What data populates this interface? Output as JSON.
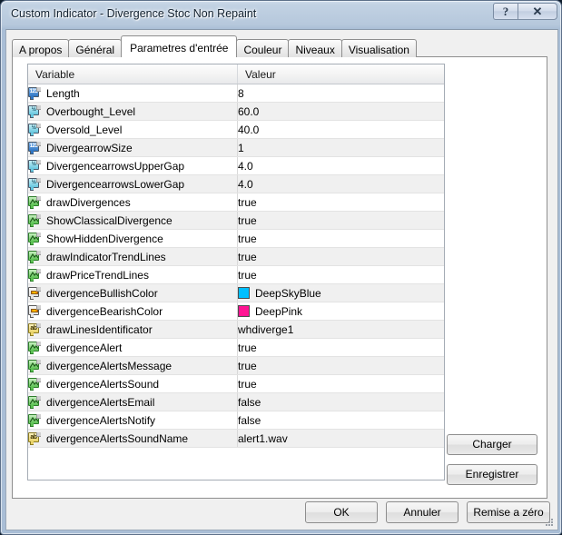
{
  "window": {
    "title": "Custom Indicator - Divergence Stoc Non Repaint",
    "help_button": "?",
    "close_button": "✕"
  },
  "tabs": [
    {
      "label": "A propos",
      "active": false
    },
    {
      "label": "Général",
      "active": false
    },
    {
      "label": "Parametres d'entrée",
      "active": true
    },
    {
      "label": "Couleur",
      "active": false
    },
    {
      "label": "Niveaux",
      "active": false
    },
    {
      "label": "Visualisation",
      "active": false
    }
  ],
  "grid": {
    "headers": [
      "Variable",
      "Valeur"
    ],
    "rows": [
      {
        "icon": "int-icon",
        "type": "int",
        "variable": "Length",
        "value": "8"
      },
      {
        "icon": "double-icon",
        "type": "double",
        "variable": "Overbought_Level",
        "value": "60.0"
      },
      {
        "icon": "double-icon",
        "type": "double",
        "variable": "Oversold_Level",
        "value": "40.0"
      },
      {
        "icon": "int-icon",
        "type": "int",
        "variable": "DivergearrowSize",
        "value": "1"
      },
      {
        "icon": "double-icon",
        "type": "double",
        "variable": "DivergencearrowsUpperGap",
        "value": "4.0"
      },
      {
        "icon": "double-icon",
        "type": "double",
        "variable": "DivergencearrowsLowerGap",
        "value": "4.0"
      },
      {
        "icon": "bool-icon",
        "type": "bool",
        "variable": "drawDivergences",
        "value": "true"
      },
      {
        "icon": "bool-icon",
        "type": "bool",
        "variable": "ShowClassicalDivergence",
        "value": "true"
      },
      {
        "icon": "bool-icon",
        "type": "bool",
        "variable": "ShowHiddenDivergence",
        "value": "true"
      },
      {
        "icon": "bool-icon",
        "type": "bool",
        "variable": "drawIndicatorTrendLines",
        "value": "true"
      },
      {
        "icon": "bool-icon",
        "type": "bool",
        "variable": "drawPriceTrendLines",
        "value": "true"
      },
      {
        "icon": "color-icon",
        "type": "color",
        "variable": "divergenceBullishColor",
        "value": "DeepSkyBlue",
        "swatch": "#00BFFF"
      },
      {
        "icon": "color-icon",
        "type": "color",
        "variable": "divergenceBearishColor",
        "value": "DeepPink",
        "swatch": "#FF1493"
      },
      {
        "icon": "string-icon",
        "type": "string",
        "variable": "drawLinesIdentificator",
        "value": "whdiverge1"
      },
      {
        "icon": "bool-icon",
        "type": "bool",
        "variable": "divergenceAlert",
        "value": "true"
      },
      {
        "icon": "bool-icon",
        "type": "bool",
        "variable": "divergenceAlertsMessage",
        "value": "true"
      },
      {
        "icon": "bool-icon",
        "type": "bool",
        "variable": "divergenceAlertsSound",
        "value": "true"
      },
      {
        "icon": "bool-icon",
        "type": "bool",
        "variable": "divergenceAlertsEmail",
        "value": "false"
      },
      {
        "icon": "bool-icon",
        "type": "bool",
        "variable": "divergenceAlertsNotify",
        "value": "false"
      },
      {
        "icon": "string-icon",
        "type": "string",
        "variable": "divergenceAlertsSoundName",
        "value": "alert1.wav"
      }
    ]
  },
  "side_buttons": {
    "load": "Charger",
    "save": "Enregistrer"
  },
  "bottom_buttons": {
    "ok": "OK",
    "cancel": "Annuler",
    "reset": "Remise a zéro"
  }
}
